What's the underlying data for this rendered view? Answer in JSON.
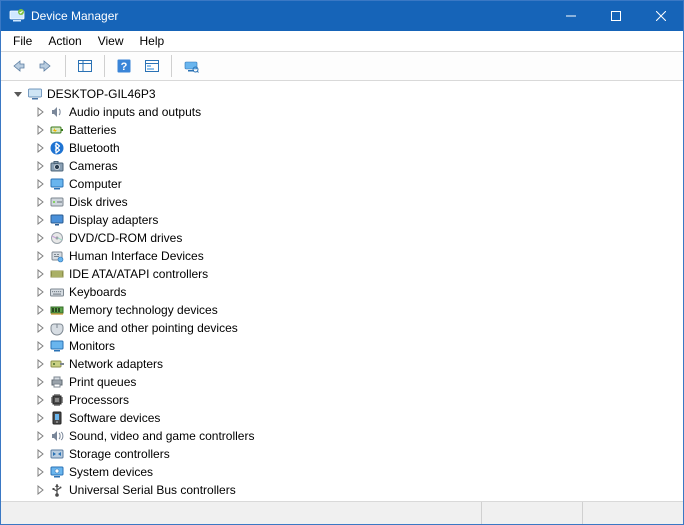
{
  "window": {
    "title": "Device Manager"
  },
  "menu": {
    "file": "File",
    "action": "Action",
    "view": "View",
    "help": "Help"
  },
  "tree": {
    "root": {
      "label": "DESKTOP-GIL46P3",
      "expanded": true
    },
    "categories": [
      {
        "label": "Audio inputs and outputs",
        "icon": "speaker"
      },
      {
        "label": "Batteries",
        "icon": "battery"
      },
      {
        "label": "Bluetooth",
        "icon": "bluetooth"
      },
      {
        "label": "Cameras",
        "icon": "camera"
      },
      {
        "label": "Computer",
        "icon": "computer"
      },
      {
        "label": "Disk drives",
        "icon": "disk"
      },
      {
        "label": "Display adapters",
        "icon": "display"
      },
      {
        "label": "DVD/CD-ROM drives",
        "icon": "optical"
      },
      {
        "label": "Human Interface Devices",
        "icon": "hid"
      },
      {
        "label": "IDE ATA/ATAPI controllers",
        "icon": "ide"
      },
      {
        "label": "Keyboards",
        "icon": "keyboard"
      },
      {
        "label": "Memory technology devices",
        "icon": "memory"
      },
      {
        "label": "Mice and other pointing devices",
        "icon": "mouse"
      },
      {
        "label": "Monitors",
        "icon": "monitor"
      },
      {
        "label": "Network adapters",
        "icon": "network"
      },
      {
        "label": "Print queues",
        "icon": "printer"
      },
      {
        "label": "Processors",
        "icon": "cpu"
      },
      {
        "label": "Software devices",
        "icon": "software"
      },
      {
        "label": "Sound, video and game controllers",
        "icon": "sound"
      },
      {
        "label": "Storage controllers",
        "icon": "storage"
      },
      {
        "label": "System devices",
        "icon": "system"
      },
      {
        "label": "Universal Serial Bus controllers",
        "icon": "usb"
      }
    ]
  }
}
